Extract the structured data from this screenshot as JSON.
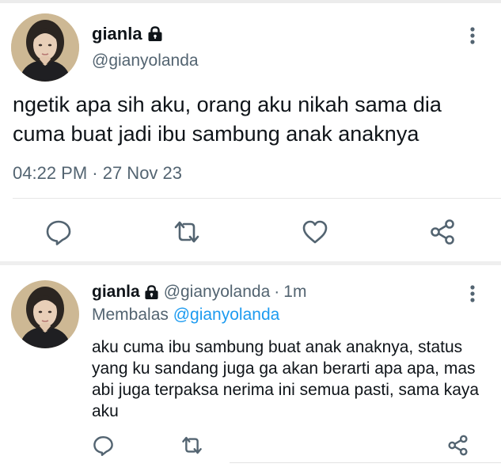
{
  "main_tweet": {
    "display_name": "gianla",
    "handle": "@gianyolanda",
    "text": "ngetik apa sih aku, orang aku nikah sama dia cuma buat jadi ibu sambung anak anaknya",
    "timestamp": "04:22 PM · 27 Nov 23",
    "actions": [
      "reply-icon",
      "retweet-icon",
      "like-icon",
      "share-icon"
    ]
  },
  "reply_tweet": {
    "display_name": "gianla",
    "handle": "@gianyolanda",
    "separator": "·",
    "time_ago": "1m",
    "replying_label": "Membalas",
    "replying_to": "@gianyolanda",
    "text": "aku cuma ibu sambung buat anak anaknya, status yang ku sandang juga ga akan berarti apa apa, mas abi juga terpaksa nerima ini semua pasti, sama kaya aku",
    "actions": [
      "reply-icon",
      "retweet-icon",
      "share-icon"
    ]
  },
  "colors": {
    "text": "#0f1419",
    "secondary": "#536471",
    "link": "#1d9bf0",
    "icon": "#536471",
    "divider": "#e6e6e6"
  }
}
